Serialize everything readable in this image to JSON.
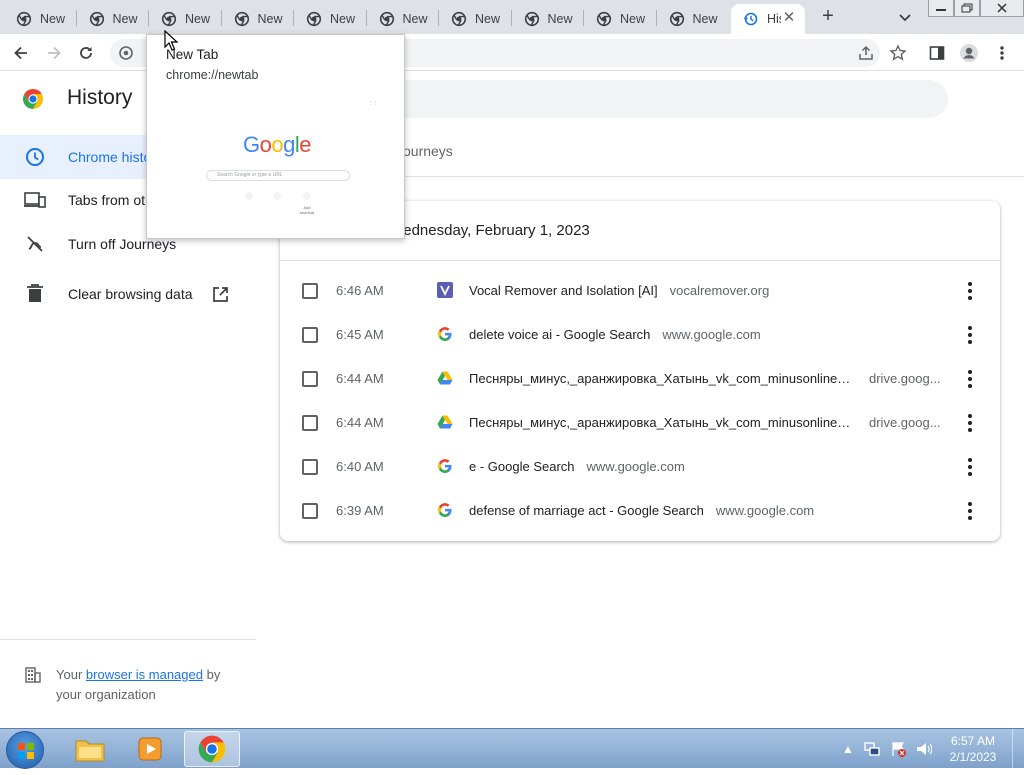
{
  "browser": {
    "tabs": [
      {
        "title": "New Tab"
      },
      {
        "title": "New Tab"
      },
      {
        "title": "New Tab"
      },
      {
        "title": "New Tab"
      },
      {
        "title": "New Tab"
      },
      {
        "title": "New Tab"
      },
      {
        "title": "New Tab"
      },
      {
        "title": "New Tab"
      },
      {
        "title": "New Tab"
      },
      {
        "title": "New Tab"
      }
    ],
    "active_tab": {
      "title": "History"
    },
    "new_tab_symbol": "+",
    "close_symbol": "✕"
  },
  "hover_card": {
    "title": "New Tab",
    "url": "chrome://newtab",
    "preview": {
      "logo": "Google",
      "search_placeholder": "Search Google or type a URL",
      "shortcuts": [
        "Add shortcut"
      ]
    }
  },
  "history": {
    "title": "History",
    "nav": [
      {
        "label": "Chrome history",
        "icon": "clock-icon"
      },
      {
        "label": "Tabs from other devices",
        "icon": "devices-icon"
      },
      {
        "label": "Turn off Journeys",
        "icon": "journeys-off-icon"
      },
      {
        "label": "Clear browsing data",
        "icon": "trash-icon"
      }
    ],
    "tab_journeys": "Journeys",
    "date_header": "Today - Wednesday, February 1, 2023",
    "entries": [
      {
        "time": "6:46 AM",
        "title": "Vocal Remover and Isolation [AI]",
        "domain": "vocalremover.org",
        "favicon": "vocalremover"
      },
      {
        "time": "6:45 AM",
        "title": "delete voice ai - Google Search",
        "domain": "www.google.com",
        "favicon": "google"
      },
      {
        "time": "6:44 AM",
        "title": "Песняры_минус,_аранжировка_Хатынь_vk_com_minusonline_...",
        "domain": "drive.goog...",
        "favicon": "drive"
      },
      {
        "time": "6:44 AM",
        "title": "Песняры_минус,_аранжировка_Хатынь_vk_com_minusonline_...",
        "domain": "drive.goog...",
        "favicon": "drive"
      },
      {
        "time": "6:40 AM",
        "title": "e - Google Search",
        "domain": "www.google.com",
        "favicon": "google"
      },
      {
        "time": "6:39 AM",
        "title": "defense of marriage act - Google Search",
        "domain": "www.google.com",
        "favicon": "google"
      }
    ],
    "managed_prefix": "Your",
    "managed_link": "browser is managed",
    "managed_suffix": "by your organization"
  },
  "taskbar": {
    "clock_time": "6:57 AM",
    "clock_date": "2/1/2023"
  },
  "colors": {
    "accent": "#1a73e8",
    "tabstrip": "#dee1e6",
    "taskbar": "#8fb0d6"
  }
}
